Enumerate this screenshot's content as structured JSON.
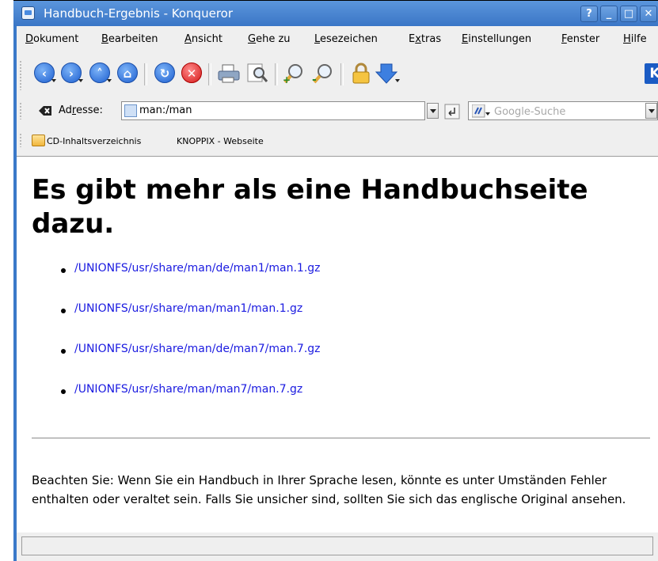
{
  "window": {
    "title": "Handbuch-Ergebnis - Konqueror",
    "buttons": [
      "?",
      "_",
      "□",
      "✕"
    ]
  },
  "menubar": {
    "items": [
      {
        "pre": "",
        "u": "D",
        "post": "okument"
      },
      {
        "pre": "",
        "u": "B",
        "post": "earbeiten"
      },
      {
        "pre": "",
        "u": "A",
        "post": "nsicht"
      },
      {
        "pre": "",
        "u": "G",
        "post": "ehe zu"
      },
      {
        "pre": "",
        "u": "L",
        "post": "esezeichen"
      },
      {
        "pre": "E",
        "u": "x",
        "post": "tras"
      },
      {
        "pre": "",
        "u": "E",
        "post": "instellungen"
      },
      {
        "pre": "",
        "u": "F",
        "post": "enster"
      },
      {
        "pre": "",
        "u": "H",
        "post": "ilfe"
      }
    ]
  },
  "toolbar": {
    "icons": [
      "back-icon",
      "forward-icon",
      "up-icon",
      "home-icon",
      "reload-icon",
      "stop-icon",
      "print-icon",
      "find-icon",
      "zoom-in-icon",
      "zoom-out-icon",
      "lock-icon",
      "download-icon",
      "kde-logo"
    ],
    "logo_text": "K"
  },
  "location": {
    "label_pre": "Ad",
    "label_u": "r",
    "label_post": "esse:",
    "url": "man:/man",
    "search_placeholder": "Google-Suche"
  },
  "bookmarks": [
    {
      "label": "CD-Inhaltsverzeichnis"
    },
    {
      "label": "KNOPPIX - Webseite"
    }
  ],
  "page": {
    "heading": "Es gibt mehr als eine Handbuchseite dazu.",
    "links": [
      "/UNIONFS/usr/share/man/de/man1/man.1.gz",
      "/UNIONFS/usr/share/man/man1/man.1.gz",
      "/UNIONFS/usr/share/man/de/man7/man.7.gz",
      "/UNIONFS/usr/share/man/man7/man.7.gz"
    ],
    "note": "Beachten Sie: Wenn Sie ein Handbuch in Ihrer Sprache lesen, könnte es unter Umständen Fehler enthalten oder veraltet sein. Falls Sie unsicher sind, sollten Sie sich das englische Original ansehen."
  },
  "colors": {
    "titlebar": "#3a76c6",
    "link": "#1a1ae0",
    "chrome": "#efefef"
  }
}
